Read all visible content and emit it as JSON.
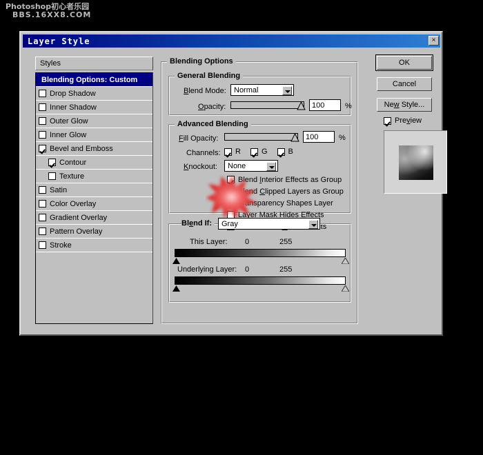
{
  "watermark": {
    "line1": "Photoshop初心者乐园",
    "line2": "BBS.16XX8.COM"
  },
  "dialog": {
    "title": "Layer Style",
    "close_label": "×"
  },
  "styles_panel": {
    "header": "Styles",
    "items": [
      {
        "label": "Blending Options: Custom",
        "checked": null,
        "selected": true,
        "sub": false
      },
      {
        "label": "Drop Shadow",
        "checked": false,
        "selected": false,
        "sub": false
      },
      {
        "label": "Inner Shadow",
        "checked": false,
        "selected": false,
        "sub": false
      },
      {
        "label": "Outer Glow",
        "checked": false,
        "selected": false,
        "sub": false
      },
      {
        "label": "Inner Glow",
        "checked": false,
        "selected": false,
        "sub": false
      },
      {
        "label": "Bevel and Emboss",
        "checked": true,
        "selected": false,
        "sub": false
      },
      {
        "label": "Contour",
        "checked": true,
        "selected": false,
        "sub": true
      },
      {
        "label": "Texture",
        "checked": false,
        "selected": false,
        "sub": true
      },
      {
        "label": "Satin",
        "checked": false,
        "selected": false,
        "sub": false
      },
      {
        "label": "Color Overlay",
        "checked": false,
        "selected": false,
        "sub": false
      },
      {
        "label": "Gradient Overlay",
        "checked": false,
        "selected": false,
        "sub": false
      },
      {
        "label": "Pattern Overlay",
        "checked": false,
        "selected": false,
        "sub": false
      },
      {
        "label": "Stroke",
        "checked": false,
        "selected": false,
        "sub": false
      }
    ]
  },
  "blending_options": {
    "group_label": "Blending Options",
    "general": {
      "group_label": "General Blending",
      "blend_mode_label": "Blend Mode:",
      "blend_mode_value": "Normal",
      "opacity_label": "Opacity:",
      "opacity_value": "100",
      "opacity_unit": "%",
      "opacity_percent": 100
    },
    "advanced": {
      "group_label": "Advanced Blending",
      "fill_opacity_label": "Fill Opacity:",
      "fill_opacity_value": "100",
      "fill_opacity_unit": "%",
      "fill_opacity_percent": 100,
      "channels_label": "Channels:",
      "channels": [
        {
          "label": "R",
          "checked": true
        },
        {
          "label": "G",
          "checked": true
        },
        {
          "label": "B",
          "checked": true
        }
      ],
      "knockout_label": "Knockout:",
      "knockout_value": "None",
      "checkboxes": [
        {
          "label": "Blend Interior Effects as Group",
          "checked": true
        },
        {
          "label": "Blend Clipped Layers as Group",
          "checked": true
        },
        {
          "label": "Transparency Shapes Layer",
          "checked": true
        },
        {
          "label": "Layer Mask Hides Effects",
          "checked": false
        },
        {
          "label": "Vector Mask Hides Effects",
          "checked": false
        }
      ]
    },
    "blend_if": {
      "label": "Blend If:",
      "value": "Gray",
      "sliders": [
        {
          "name": "This Layer:",
          "min": "0",
          "max": "255"
        },
        {
          "name": "Underlying Layer:",
          "min": "0",
          "max": "255"
        }
      ]
    }
  },
  "buttons": {
    "ok": "OK",
    "cancel": "Cancel",
    "new_style": "New Style...",
    "preview_label": "Preview",
    "preview_checked": true
  },
  "annotation": {
    "type": "starburst-highlight",
    "color": "#e01b1b",
    "target": "Blend Interior Effects as Group"
  }
}
